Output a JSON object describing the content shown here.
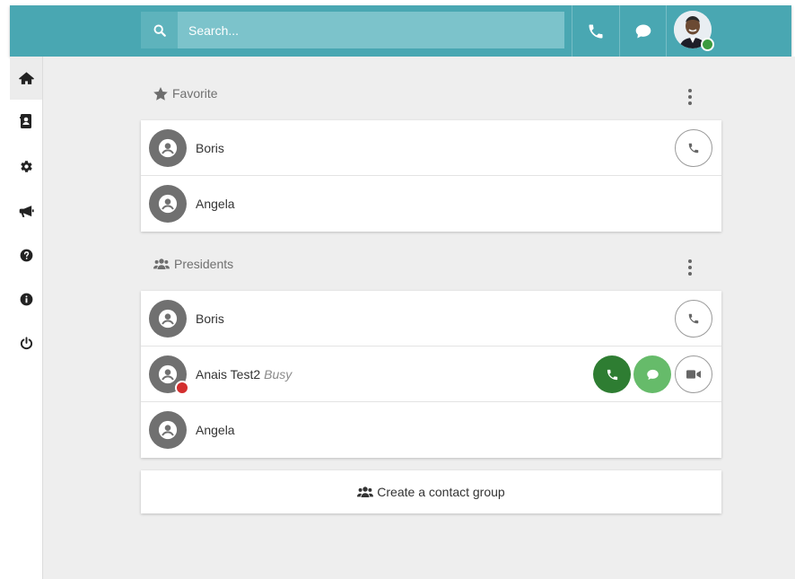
{
  "colors": {
    "topbar": "#49a7b2",
    "search_bg": "#7cc3cb",
    "online": "#3b9b3f",
    "busy": "#d32f2f",
    "call_green": "#2e7d32",
    "chat_green": "#66bb6a"
  },
  "header": {
    "search_placeholder": "Search...",
    "icons": [
      "search-icon",
      "phone-icon",
      "chat-icon"
    ],
    "user_status": "online"
  },
  "sidebar": {
    "items": [
      {
        "icon": "home-icon",
        "active": true
      },
      {
        "icon": "contacts-icon",
        "active": false
      },
      {
        "icon": "gear-icon",
        "active": false
      },
      {
        "icon": "megaphone-icon",
        "active": false
      },
      {
        "icon": "help-icon",
        "active": false
      },
      {
        "icon": "info-icon",
        "active": false
      },
      {
        "icon": "power-icon",
        "active": false
      }
    ]
  },
  "groups": [
    {
      "title": "Favorite",
      "icon": "star-icon",
      "contacts": [
        {
          "name": "Boris",
          "status": "",
          "actions": [
            "call"
          ]
        },
        {
          "name": "Angela",
          "status": "",
          "actions": []
        }
      ]
    },
    {
      "title": "Presidents",
      "icon": "users-icon",
      "contacts": [
        {
          "name": "Boris",
          "status": "",
          "actions": [
            "call"
          ]
        },
        {
          "name": "Anais Test2",
          "status": "Busy",
          "actions": [
            "call",
            "chat",
            "video"
          ]
        },
        {
          "name": "Angela",
          "status": "",
          "actions": []
        }
      ]
    }
  ],
  "create_group": {
    "label": "Create a contact group",
    "icon": "users-icon"
  }
}
